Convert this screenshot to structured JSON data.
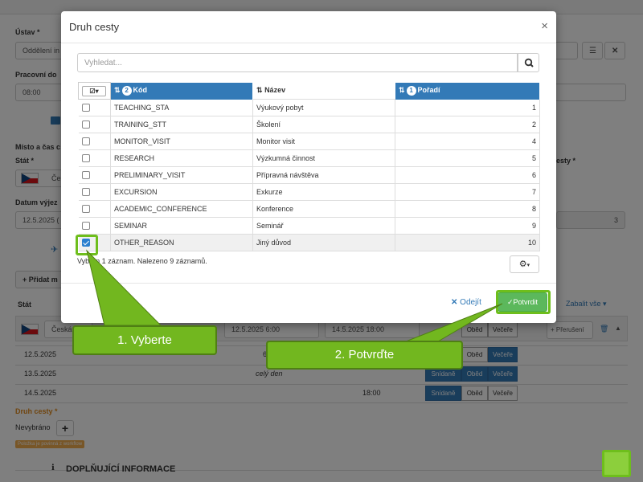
{
  "background": {
    "ustav_label": "Ústav *",
    "ustav_value": "Oddělení in",
    "pracovni_label": "Pracovní do",
    "pracovni_value": "08:00",
    "misto_label": "Místo a čas c",
    "stat_label": "Stát *",
    "stat_value": "Če",
    "cesty_label": "esty *",
    "datum_label": "Datum výjez",
    "datum_value": "12.5.2025 (",
    "right_value": "3",
    "pridat_label": "+ Přidat m",
    "stat_col": "Stát",
    "zabalit": "Zabalit vše",
    "country_value": "Česká",
    "depart_value": "12.5.2025 6:00",
    "arrive_value": "14.5.2025 18:00",
    "preruseni": "+ Přerušení",
    "meal_labels": [
      "Snídaně",
      "Oběd",
      "Večeře"
    ],
    "days": [
      {
        "date": "12.5.2025",
        "note": "6",
        "time": ""
      },
      {
        "date": "13.5.2025",
        "note": "celý den",
        "time": ""
      },
      {
        "date": "14.5.2025",
        "note": "",
        "time": "18:00"
      }
    ],
    "druh_label": "Druh cesty *",
    "nevybrano": "Nevybráno",
    "workflow_badge": "Položka je povinná z workflow",
    "section_title": "DOPLŇUJÍCÍ INFORMACE"
  },
  "modal": {
    "title": "Druh cesty",
    "search_placeholder": "Vyhledat...",
    "columns": {
      "code": "Kód",
      "code_sort": "2",
      "name": "Název",
      "order": "Pořadí",
      "order_sort": "1"
    },
    "rows": [
      {
        "code": "TEACHING_STA",
        "name": "Výukový pobyt",
        "order": "1",
        "checked": false
      },
      {
        "code": "TRAINING_STT",
        "name": "Školení",
        "order": "2",
        "checked": false
      },
      {
        "code": "MONITOR_VISIT",
        "name": "Monitor visit",
        "order": "4",
        "checked": false
      },
      {
        "code": "RESEARCH",
        "name": "Výzkumná činnost",
        "order": "5",
        "checked": false
      },
      {
        "code": "PRELIMINARY_VISIT",
        "name": "Přípravná návštěva",
        "order": "6",
        "checked": false
      },
      {
        "code": "EXCURSION",
        "name": "Exkurze",
        "order": "7",
        "checked": false
      },
      {
        "code": "ACADEMIC_CONFERENCE",
        "name": "Konference",
        "order": "8",
        "checked": false
      },
      {
        "code": "SEMINAR",
        "name": "Seminář",
        "order": "9",
        "checked": false
      },
      {
        "code": "OTHER_REASON",
        "name": "Jiný důvod",
        "order": "10",
        "checked": true
      }
    ],
    "selection_info": "Vybrán 1 záznam. Nalezeno 9 záznamů.",
    "cancel_label": "Odejít",
    "confirm_label": "Potvrdit"
  },
  "callouts": {
    "step1": "1. Vyberte",
    "step2": "2. Potvrďte"
  },
  "colors": {
    "header_blue": "#337ab7",
    "confirm_green": "#5cb85c",
    "callout_green": "#72b71f"
  }
}
